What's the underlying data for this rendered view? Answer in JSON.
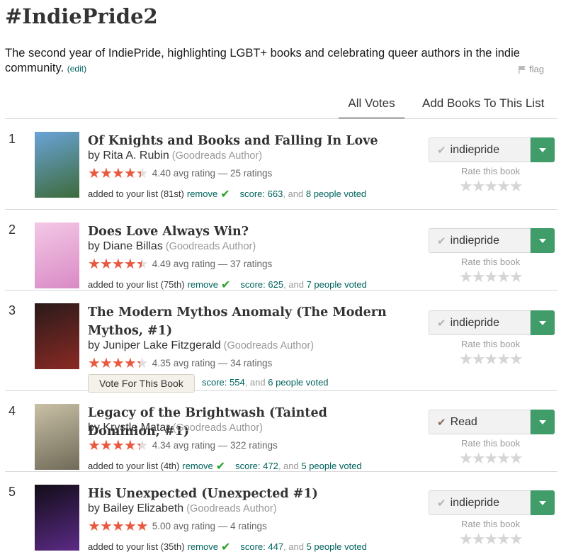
{
  "list": {
    "title": "#IndiePride2",
    "description": "The second year of IndiePride, highlighting LGBT+ books and celebrating queer authors in the indie community.",
    "edit_label": "(edit)",
    "flag_label": "flag"
  },
  "tabs": {
    "all_votes": "All Votes",
    "add_books": "Add Books To This List"
  },
  "labels": {
    "by": "by",
    "goodreads_author": "(Goodreads Author)",
    "added_prefix": "added to your list",
    "remove": "remove",
    "score_prefix": "score:",
    "and": ", and",
    "people_voted_suffix": "people voted",
    "rate_this_book": "Rate this book",
    "vote_for_book": "Vote For This Book",
    "avg_rating_suffix": "avg rating —",
    "ratings_suffix": "ratings"
  },
  "books": [
    {
      "rank": "1",
      "title": "Of Knights and Books and Falling In Love",
      "author": "Rita A. Rubin",
      "avg": "4.40",
      "rating_count": "25",
      "stars_fraction": 0.88,
      "added_position": "(81st)",
      "score": "663",
      "voters": "8",
      "shelf": "indiepride",
      "cover_colors": [
        "#6aa3d8",
        "#3d6b3a"
      ]
    },
    {
      "rank": "2",
      "title": "Does Love Always Win?",
      "author": "Diane Billas",
      "avg": "4.49",
      "rating_count": "37",
      "stars_fraction": 0.898,
      "added_position": "(75th)",
      "score": "625",
      "voters": "7",
      "shelf": "indiepride",
      "cover_colors": [
        "#f3c8e6",
        "#d98ac4"
      ]
    },
    {
      "rank": "3",
      "title": "The Modern Mythos Anomaly (The Modern Mythos, #1)",
      "author": "Juniper Lake Fitzgerald",
      "avg": "4.35",
      "rating_count": "34",
      "stars_fraction": 0.87,
      "added_position": "",
      "score": "554",
      "voters": "6",
      "shelf": "indiepride",
      "cover_colors": [
        "#2a1a1a",
        "#8a2a24"
      ]
    },
    {
      "rank": "4",
      "title": "Legacy of the Brightwash (Tainted Dominion, #1)",
      "author": "Krystle Matar",
      "avg": "4.34",
      "rating_count": "322",
      "stars_fraction": 0.868,
      "added_position": "(4th)",
      "score": "472",
      "voters": "5",
      "shelf": "Read",
      "cover_colors": [
        "#c9c0a6",
        "#6f6a58"
      ]
    },
    {
      "rank": "5",
      "title": "His Unexpected (Unexpected #1)",
      "author": "Bailey Elizabeth",
      "avg": "5.00",
      "rating_count": "4",
      "stars_fraction": 1.0,
      "added_position": "(35th)",
      "score": "447",
      "voters": "5",
      "shelf": "indiepride",
      "cover_colors": [
        "#120d18",
        "#5b2a86"
      ]
    }
  ],
  "colors": {
    "accent_green": "#409d69",
    "link": "#00635d",
    "star_filled": "#e8593f"
  }
}
